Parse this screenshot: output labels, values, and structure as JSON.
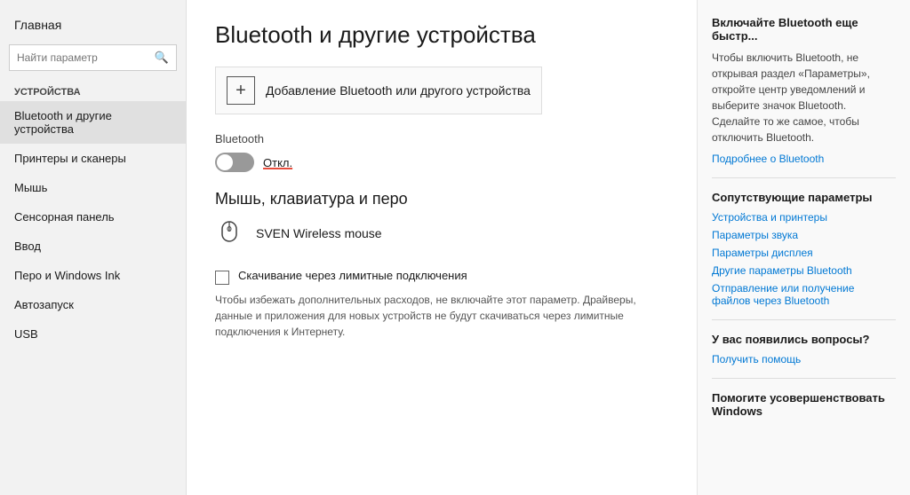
{
  "sidebar": {
    "home_label": "Главная",
    "search_placeholder": "Найти параметр",
    "section_title": "Устройства",
    "items": [
      {
        "id": "bluetooth",
        "label": "Bluetooth и другие устройства",
        "active": true
      },
      {
        "id": "printers",
        "label": "Принтеры и сканеры",
        "active": false
      },
      {
        "id": "mouse",
        "label": "Мышь",
        "active": false
      },
      {
        "id": "touchpad",
        "label": "Сенсорная панель",
        "active": false
      },
      {
        "id": "input",
        "label": "Ввод",
        "active": false
      },
      {
        "id": "pen",
        "label": "Перо и Windows Ink",
        "active": false
      },
      {
        "id": "autostart",
        "label": "Автозапуск",
        "active": false
      },
      {
        "id": "usb",
        "label": "USB",
        "active": false
      }
    ]
  },
  "main": {
    "page_title": "Bluetooth и другие устройства",
    "add_device_label": "Добавление Bluetooth или другого устройства",
    "bluetooth_section_label": "Bluetooth",
    "bluetooth_toggle_state": "off",
    "bluetooth_toggle_label": "Откл.",
    "mouse_section_heading": "Мышь, клавиатура и перо",
    "device_name": "SVEN Wireless mouse",
    "checkbox_label": "Скачивание через лимитные подключения",
    "checkbox_desc": "Чтобы избежать дополнительных расходов, не включайте этот параметр. Драйверы, данные и приложения для новых устройств не будут скачиваться через лимитные подключения к Интернету."
  },
  "right_panel": {
    "quick_title": "Включайте Bluetooth еще быстр...",
    "quick_text": "Чтобы включить Bluetooth, не открывая раздел «Параметры», откройте центр уведомлений и выберите значок Bluetooth. Сделайте то же самое, чтобы отключить Bluetooth.",
    "quick_link": "Подробнее о Bluetooth",
    "related_title": "Сопутствующие параметры",
    "links": [
      "Устройства и принтеры",
      "Параметры звука",
      "Параметры дисплея",
      "Другие параметры Bluetooth",
      "Отправление или получение файлов через Bluetooth"
    ],
    "questions_title": "У вас появились вопросы?",
    "questions_link": "Получить помощь",
    "improve_title": "Помогите усовершенствовать Windows"
  }
}
